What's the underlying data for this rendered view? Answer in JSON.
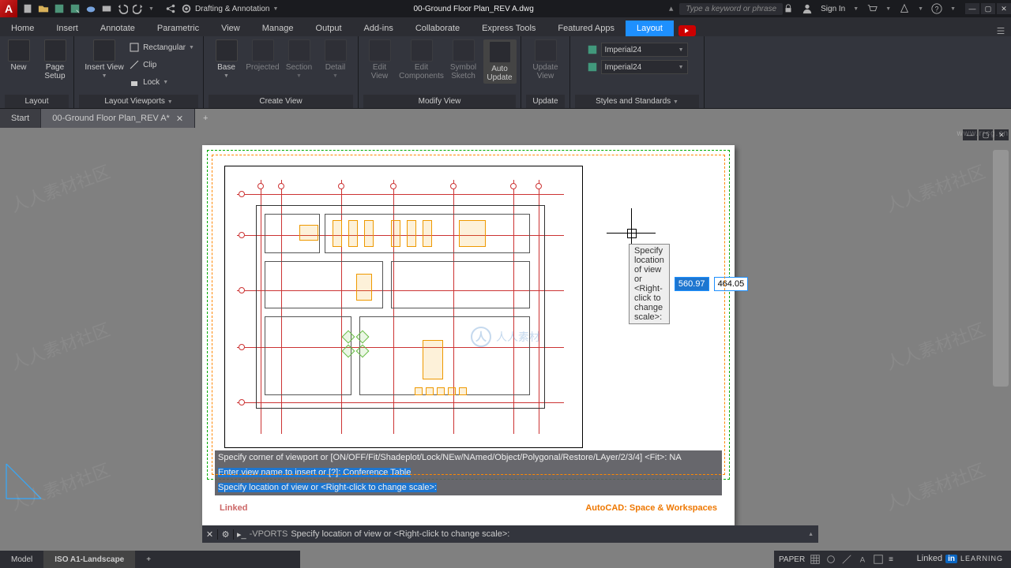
{
  "title": "00-Ground Floor Plan_REV A.dwg",
  "workspace": "Drafting & Annotation",
  "search_placeholder": "Type a keyword or phrase",
  "sign_in": "Sign In",
  "menus": [
    "Home",
    "Insert",
    "Annotate",
    "Parametric",
    "View",
    "Manage",
    "Output",
    "Add-ins",
    "Collaborate",
    "Express Tools",
    "Featured Apps",
    "Layout"
  ],
  "active_menu": "Layout",
  "ribbon": {
    "layout": {
      "title": "Layout",
      "new": "New",
      "page_setup": "Page\nSetup"
    },
    "viewports": {
      "title": "Layout Viewports",
      "insert": "Insert View",
      "rect": "Rectangular",
      "clip": "Clip",
      "lock": "Lock"
    },
    "create_view": {
      "title": "Create View",
      "base": "Base",
      "projected": "Projected",
      "section": "Section",
      "detail": "Detail"
    },
    "modify_view": {
      "title": "Modify View",
      "edit_view": "Edit\nView",
      "edit_comp": "Edit\nComponents",
      "symbol": "Symbol\nSketch",
      "auto": "Auto\nUpdate"
    },
    "update": {
      "title": "Update",
      "update_view": "Update\nView"
    },
    "styles": {
      "title": "Styles and Standards",
      "dd1": "Imperial24",
      "dd2": "Imperial24"
    }
  },
  "filetabs": {
    "start": "Start",
    "doc": "00-Ground Floor Plan_REV A*"
  },
  "tooltip": {
    "text": "Specify location of view or <Right-click to change scale>:",
    "val1": "560.97",
    "val2": "464.05"
  },
  "cmd_overlay": {
    "l1": "Specify corner of viewport or [ON/OFF/Fit/Shadeplot/Lock/NEw/NAmed/Object/Polygonal/Restore/LAyer/2/3/4] <Fit>: NA",
    "l2": "Enter view name to insert or [?]: Conference Table",
    "l3": "Specify location of view or <Right-click to change scale>:"
  },
  "label_left": "Linked",
  "label_right": "AutoCAD: Space & Workspaces",
  "cmd_bar": {
    "cmd": "-VPORTS",
    "rest": "Specify location of view or <Right-click to change scale>:"
  },
  "layout_tabs": {
    "model": "Model",
    "iso": "ISO A1-Landscape"
  },
  "status": {
    "paper": "PAPER"
  },
  "linkedin": {
    "brand": "Linked",
    "learn": "LEARNING"
  },
  "watermark": {
    "cn": "人人素材社区",
    "url": "www.rrcg.cn",
    "center": "人人素材"
  }
}
